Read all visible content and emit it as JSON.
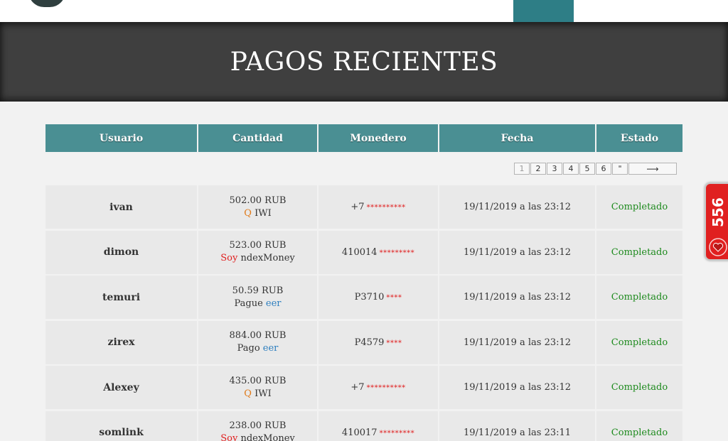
{
  "page": {
    "title": "PAGOS RECIENTES"
  },
  "table": {
    "headers": [
      "Usuario",
      "Cantidad",
      "Monedero",
      "Fecha",
      "Estado"
    ],
    "rows": [
      {
        "user": "ivan",
        "amount": "502.00 RUB",
        "method_accent": "Q",
        "method_rest": " IWI",
        "accent_color": "#e07a1a",
        "wallet": "+7",
        "wallet_mask": "**********",
        "date": "19/11/2019 a las 23:12",
        "status": "Completado"
      },
      {
        "user": "dimon",
        "amount": "523.00 RUB",
        "method_accent": "Soy",
        "method_rest": " ndexMoney",
        "accent_color": "#e02020",
        "wallet": "410014",
        "wallet_mask": "*********",
        "date": "19/11/2019 a las 23:12",
        "status": "Completado"
      },
      {
        "user": "temuri",
        "amount": "50.59 RUB",
        "method_accent": "Pague ",
        "method_rest": "eer",
        "accent_color": "#333333",
        "wallet": "P3710",
        "wallet_mask": "****",
        "date": "19/11/2019 a las 23:12",
        "status": "Completado"
      },
      {
        "user": "zirex",
        "amount": "884.00 RUB",
        "method_accent": "Pago ",
        "method_rest": "eer",
        "accent_color": "#333333",
        "wallet": "P4579",
        "wallet_mask": "****",
        "date": "19/11/2019 a las 23:12",
        "status": "Completado"
      },
      {
        "user": "Alexey",
        "amount": "435.00 RUB",
        "method_accent": "Q",
        "method_rest": " IWI",
        "accent_color": "#e07a1a",
        "wallet": "+7",
        "wallet_mask": "**********",
        "date": "19/11/2019 a las 23:12",
        "status": "Completado"
      },
      {
        "user": "somlink",
        "amount": "238.00 RUB",
        "method_accent": "Soy",
        "method_rest": " ndexMoney",
        "accent_color": "#e02020",
        "wallet": "410017",
        "wallet_mask": "*********",
        "date": "19/11/2019 a las 23:11",
        "status": "Completado"
      }
    ]
  },
  "pagination": {
    "pages": [
      "1",
      "2",
      "3",
      "4",
      "5",
      "6",
      "\""
    ],
    "next_label": "⟶"
  },
  "side_badge": {
    "count": "556",
    "icon": "heart-icon"
  },
  "colors": {
    "header_bg": "#4a8f93",
    "banner_bg": "#3f3f3f",
    "nav_active": "#2e7e86",
    "status_green": "#1d8a1d",
    "mask_red": "#e02020",
    "badge_red": "#e02020"
  }
}
